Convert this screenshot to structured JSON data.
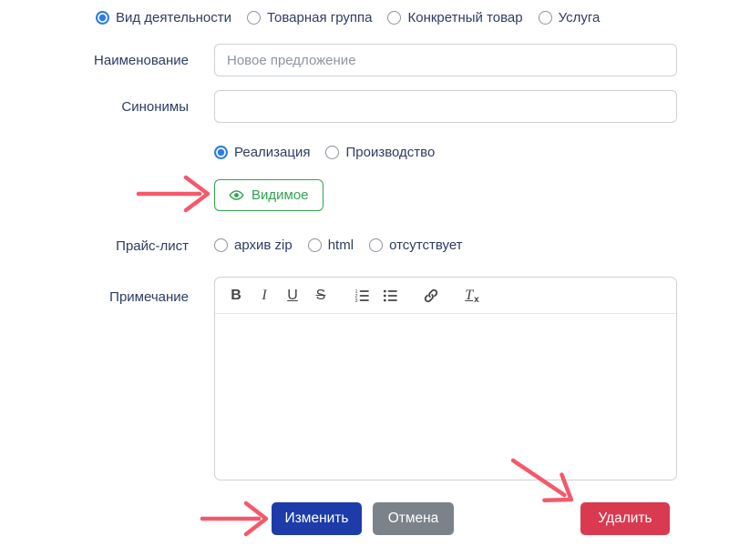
{
  "activity_types": {
    "options": [
      {
        "label": "Вид деятельности",
        "selected": true
      },
      {
        "label": "Товарная группа",
        "selected": false
      },
      {
        "label": "Конкретный товар",
        "selected": false
      },
      {
        "label": "Услуга",
        "selected": false
      }
    ]
  },
  "name_field": {
    "label": "Наименование",
    "value": "",
    "placeholder": "Новое предложение"
  },
  "synonyms_field": {
    "label": "Синонимы",
    "value": "",
    "placeholder": ""
  },
  "operation_type": {
    "options": [
      {
        "label": "Реализация",
        "selected": true
      },
      {
        "label": "Производство",
        "selected": false
      }
    ]
  },
  "visibility_button": {
    "label": "Видимое",
    "icon": "eye-icon"
  },
  "price_list": {
    "label": "Прайс-лист",
    "options": [
      {
        "label": "архив zip",
        "selected": false
      },
      {
        "label": "html",
        "selected": false
      },
      {
        "label": "отсутствует",
        "selected": false
      }
    ]
  },
  "note_field": {
    "label": "Примечание",
    "value": "",
    "toolbar": [
      "bold",
      "italic",
      "underline",
      "strike",
      "ordered-list",
      "bullet-list",
      "link",
      "clean-format"
    ],
    "toolbar_glyphs": {
      "bold": "B",
      "italic": "I",
      "underline": "U",
      "strike": "S",
      "clean_t": "T",
      "clean_x": "x"
    }
  },
  "actions": {
    "edit": "Изменить",
    "cancel": "Отмена",
    "delete": "Удалить"
  },
  "annotations": {
    "arrows": [
      "arrow-to-visible-button",
      "arrow-to-edit-button",
      "arrow-to-delete-button"
    ]
  },
  "colors": {
    "radio-blue": "#2b7ce9",
    "label-navy": "#2e3c63",
    "success-green": "#2fa450",
    "primary-blue": "#1d3caa",
    "secondary-gray": "#7b8289",
    "danger-red": "#d93a50",
    "arrow-pink": "#f4596b",
    "input-border": "#ccd2d8",
    "placeholder-gray": "#8e959c",
    "toolbar-icon": "#444444"
  }
}
